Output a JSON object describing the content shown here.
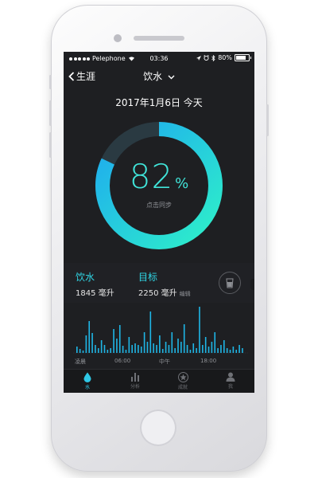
{
  "status": {
    "carrier": "Pelephone",
    "time": "03:36",
    "battery": "80%",
    "battery_level": 0.8
  },
  "nav": {
    "back_label": "生涯",
    "title": "饮水"
  },
  "date": "2017年1月6日 今天",
  "progress": {
    "percent_value": "82",
    "percent_sign": "%",
    "fraction": 0.82,
    "sync_label": "点击同步"
  },
  "stats": {
    "drink": {
      "title": "饮水",
      "value": "1845 毫升"
    },
    "goal": {
      "title": "目标",
      "value": "2250 毫升",
      "edit_label": "编辑"
    }
  },
  "chart_data": {
    "type": "bar",
    "x_labels": [
      "凌晨",
      "06:00",
      "中午",
      "18:00"
    ],
    "values": [
      8,
      5,
      3,
      22,
      40,
      25,
      10,
      6,
      16,
      10,
      4,
      6,
      30,
      18,
      35,
      9,
      4,
      20,
      10,
      12,
      10,
      8,
      26,
      14,
      52,
      12,
      10,
      22,
      5,
      14,
      10,
      26,
      6,
      18,
      14,
      36,
      10,
      4,
      12,
      6,
      58,
      10,
      20,
      8,
      14,
      26,
      6,
      10,
      16,
      6,
      4,
      8,
      4,
      10,
      6
    ],
    "bar_color": "#1fb6e6"
  },
  "tabs": [
    {
      "label": "水",
      "icon": "water-drop-icon",
      "active": true
    },
    {
      "label": "分析",
      "icon": "bar-chart-icon",
      "active": false
    },
    {
      "label": "成就",
      "icon": "star-badge-icon",
      "active": false
    },
    {
      "label": "我",
      "icon": "person-icon",
      "active": false
    }
  ],
  "colors": {
    "accent": "#30d7e6",
    "ring_track": "#2a3a42",
    "ring_start": "#2ef0c9",
    "ring_end": "#1ea9f0",
    "screen_bg": "#1e1f22"
  }
}
